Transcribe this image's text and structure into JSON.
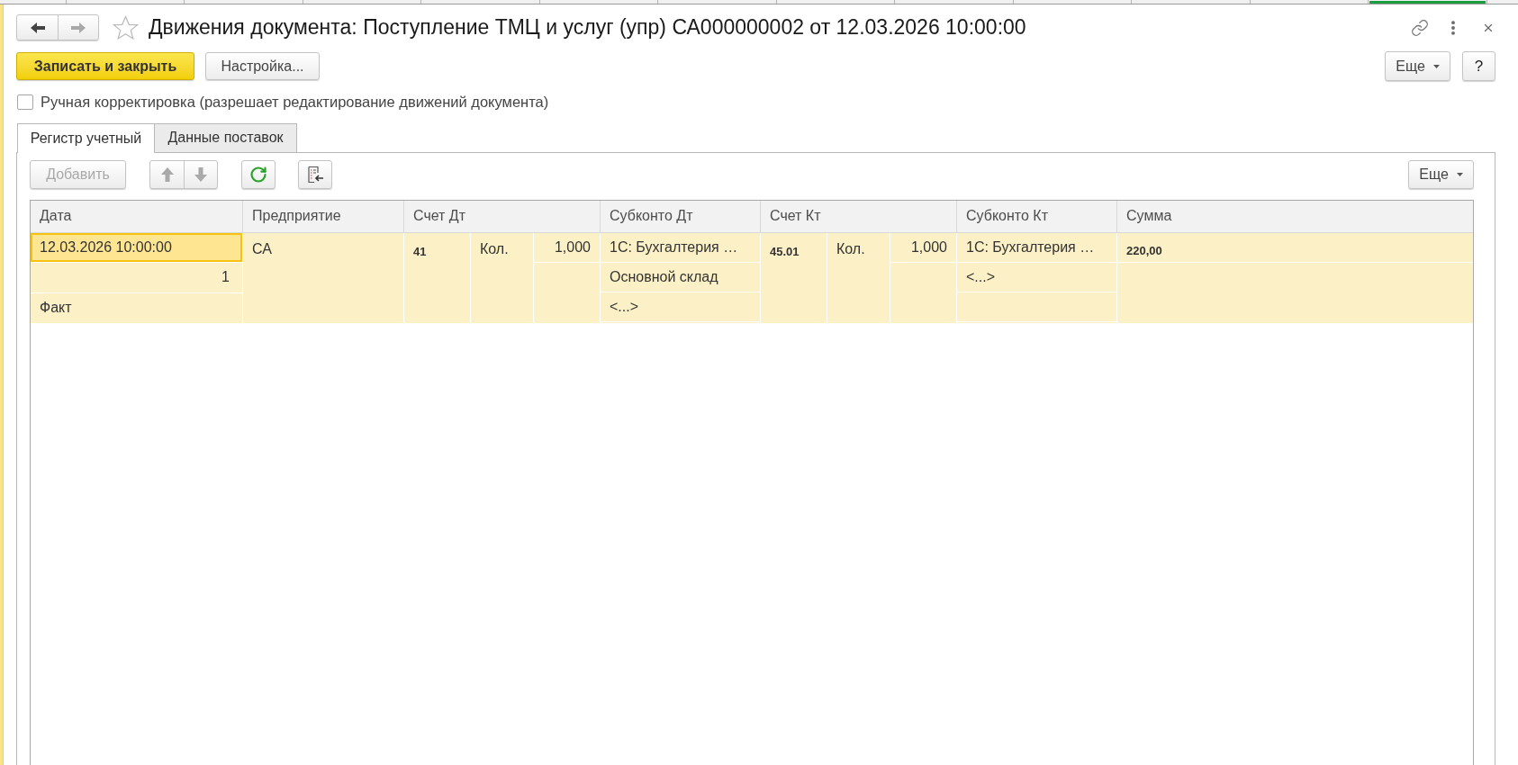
{
  "window_tabs": [
    {
      "selected": false
    },
    {
      "selected": false
    },
    {
      "selected": false
    },
    {
      "selected": false
    },
    {
      "selected": false
    },
    {
      "selected": false
    },
    {
      "selected": false
    },
    {
      "selected": false
    },
    {
      "selected": false
    },
    {
      "selected": false
    },
    {
      "selected": false
    },
    {
      "selected": false
    },
    {
      "selected": true
    },
    {
      "selected": false
    }
  ],
  "nav_buttons": [
    {
      "kind": "back",
      "disabled": false
    },
    {
      "kind": "forward",
      "disabled": true
    }
  ],
  "favorite": {
    "on": false
  },
  "title": "Движения документа: Поступление ТМЦ и услуг (упр) СА000000002 от 12.03.2026 10:00:00",
  "command_bar": {
    "buttons": [
      {
        "kind": "primary",
        "label": "Записать и закрыть"
      },
      {
        "kind": "default",
        "label": "Настройка..."
      }
    ],
    "more": "Еще",
    "help": "?"
  },
  "manual_edit": {
    "label": "Ручная корректировка (разрешает редактирование движений документа)",
    "checked": false
  },
  "tabs": [
    {
      "label": "Регистр учетный",
      "selected": true
    },
    {
      "label": "Данные поставок",
      "selected": false
    }
  ],
  "toolbar": {
    "add": {
      "label": "Добавить",
      "disabled": true
    },
    "move_up": {
      "disabled": true
    },
    "move_down": {
      "disabled": true
    },
    "more": "Еще"
  },
  "table": {
    "columns": [
      "Дата",
      "Предприятие",
      "Счет Дт",
      "Субконто Дт",
      "Счет Кт",
      "Субконто Кт",
      "Сумма"
    ],
    "rows": [
      {
        "selected": true,
        "date": "12.03.2026 10:00:00",
        "number": "1",
        "kind_label": "Факт",
        "enterprise": "СА",
        "debit_account": "41",
        "debit_qty_label": "Кол.",
        "debit_qty": "1,000",
        "debit_subconto": [
          "1С: Бухгалтерия …",
          "Основной склад",
          "<...>"
        ],
        "credit_account": "45.01",
        "credit_qty_label": "Кол.",
        "credit_qty": "1,000",
        "credit_subconto": [
          "1С: Бухгалтерия …",
          "<...>"
        ],
        "amount": "220,00"
      }
    ]
  }
}
